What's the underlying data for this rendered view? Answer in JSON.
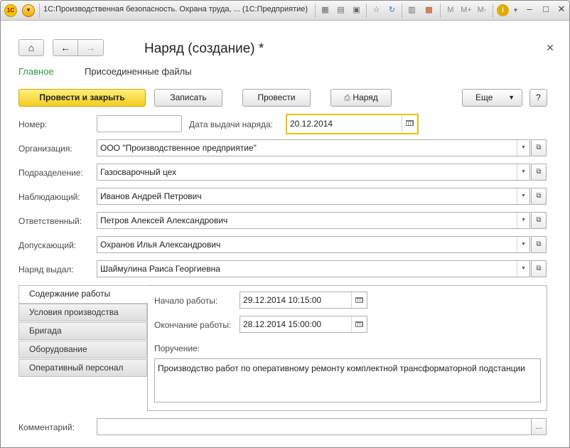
{
  "app": {
    "window_title": "1С:Производственная безопасность. Охрана труда, ... (1С:Предприятие)",
    "logo_text": "1С",
    "toolbar_icons": [
      "save-icon",
      "print-icon",
      "preview-icon",
      "favorite-icon",
      "history-icon",
      "calculator-icon",
      "calendar-icon"
    ],
    "memory": {
      "m": "M",
      "m_plus": "M+",
      "m_minus": "M-"
    },
    "info_label": "i"
  },
  "form": {
    "title": "Наряд (создание) *",
    "tabs": [
      {
        "label": "Главное",
        "active": true
      },
      {
        "label": "Присоединенные файлы",
        "active": false
      }
    ],
    "buttons": {
      "post_close": "Провести и закрыть",
      "save": "Записать",
      "post": "Провести",
      "print": "Наряд",
      "more": "Еще",
      "help": "?"
    },
    "fields": {
      "number": {
        "label": "Номер:",
        "value": ""
      },
      "issue_date": {
        "label": "Дата выдачи наряда:",
        "value": "20.12.2014"
      },
      "organization": {
        "label": "Организация:",
        "value": "ООО \"Производственное предприятие\""
      },
      "department": {
        "label": "Подразделение:",
        "value": "Газосварочный цех"
      },
      "observer": {
        "label": "Наблюдающий:",
        "value": "Иванов Андрей Петрович"
      },
      "responsible": {
        "label": "Ответственный:",
        "value": "Петров Алексей Александрович"
      },
      "admitting": {
        "label": "Допускающий:",
        "value": "Охранов Илья Александрович"
      },
      "issued_by": {
        "label": "Наряд выдал:",
        "value": "Шаймулина Раиса Георгиевна"
      },
      "comment": {
        "label": "Комментарий:",
        "value": ""
      }
    },
    "side_tabs": [
      "Содержание работы",
      "Условия производства",
      "Бригада",
      "Оборудование",
      "Оперативный персонал"
    ],
    "work": {
      "start_label": "Начало работы:",
      "start_value": "29.12.2014 10:15:00",
      "end_label": "Окончание работы:",
      "end_value": "28.12.2014 15:00:00",
      "assignment_label": "Поручение:",
      "assignment_value": "Производство работ по оперативному ремонту комплектной трансформаторной подстанции"
    },
    "accent_color": "#f4cd1e",
    "active_tab_color": "#2b9a3e"
  }
}
